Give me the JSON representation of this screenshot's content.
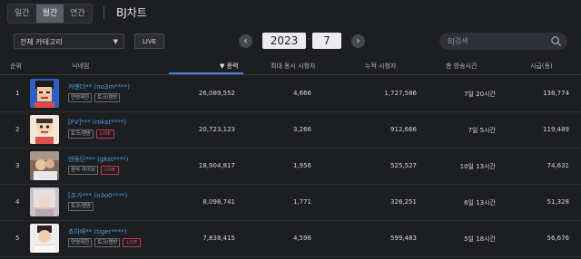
{
  "period_tabs": [
    {
      "label": "일간",
      "active": false
    },
    {
      "label": "월간",
      "active": true
    },
    {
      "label": "연간",
      "active": false
    }
  ],
  "page_title": "BJ차트",
  "category_select": {
    "value": "전체 카테고리"
  },
  "live_button": "LIVE",
  "date": {
    "prev_icon": "‹",
    "year": "2023",
    "separator": "-",
    "month": "7",
    "next_icon": "›"
  },
  "search": {
    "placeholder": "BJ검색",
    "icon": "search-icon"
  },
  "columns": {
    "rank": "순위",
    "nickname": "닉네임",
    "fire": "▼ 풍력",
    "max_viewers": "최대 동시 시청자",
    "total_viewers": "누적 시청자",
    "broadcast_time": "총 방송시간",
    "revenue": "시급(동)"
  },
  "rows": [
    {
      "rank": "1",
      "name": "커맨더**",
      "id": "(no3m****)",
      "tags": [
        "연령제한",
        "토크/캠방"
      ],
      "live": "",
      "fire": "26,089,552",
      "max": "4,666",
      "total": "1,727,586",
      "time": "7일 20시간",
      "rev": "138,774"
    },
    {
      "rank": "2",
      "name": "[FV]***",
      "id": "(rokst****)",
      "tags": [
        "토크/캠방"
      ],
      "live": "LIVE",
      "fire": "20,723,123",
      "max": "3,266",
      "total": "912,666",
      "time": "7일 5시간",
      "rev": "119,489"
    },
    {
      "rank": "3",
      "name": "댄동단***",
      "id": "(gkst****)",
      "tags": [
        "음악 라이브"
      ],
      "live": "LIVE",
      "fire": "18,904,817",
      "max": "1,956",
      "total": "525,527",
      "time": "10일 13시간",
      "rev": "74,631"
    },
    {
      "rank": "4",
      "name": "[조가***",
      "id": "(o3o0****)",
      "tags": [
        "토크/캠방"
      ],
      "live": "",
      "fire": "8,098,741",
      "max": "1,771",
      "total": "326,251",
      "time": "6일 13시간",
      "rev": "51,328"
    },
    {
      "rank": "5",
      "name": "쵸아애**",
      "id": "(tiger****)",
      "tags": [
        "연령제한",
        "토크/캠방"
      ],
      "live": "LIVE",
      "fire": "7,838,415",
      "max": "4,598",
      "total": "599,483",
      "time": "5일 18시간",
      "rev": "56,676"
    }
  ]
}
